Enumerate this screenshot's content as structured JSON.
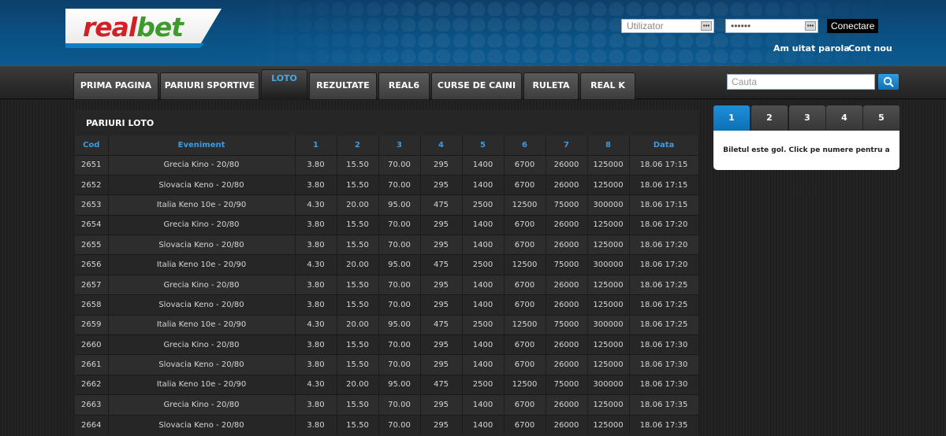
{
  "brand": {
    "logo_real": "real",
    "logo_bet": "bet"
  },
  "login": {
    "username_placeholder": "Utilizator",
    "password_value": "••••••",
    "login_button": "Conectare",
    "forgot_password": "Am uitat parola",
    "new_account": "Cont nou"
  },
  "nav": {
    "tabs": [
      {
        "label": "PRIMA PAGINA",
        "active": false
      },
      {
        "label": "PARIURI SPORTIVE",
        "active": false
      },
      {
        "label": "LOTO",
        "active": true
      },
      {
        "label": "REZULTATE",
        "active": false
      },
      {
        "label": "REAL6",
        "active": false
      },
      {
        "label": "CURSE DE CAINI",
        "active": false
      },
      {
        "label": "RULETA",
        "active": false
      },
      {
        "label": "REAL K",
        "active": false
      }
    ],
    "search_placeholder": "Cauta",
    "search_icon": "search-icon"
  },
  "main": {
    "section_title": "PARIURI LOTO",
    "columns": [
      "Cod",
      "Eveniment",
      "1",
      "2",
      "3",
      "4",
      "5",
      "6",
      "7",
      "8",
      "Data"
    ],
    "rows": [
      [
        "2651",
        "Grecia Kino - 20/80",
        "3.80",
        "15.50",
        "70.00",
        "295",
        "1400",
        "6700",
        "26000",
        "125000",
        "18.06 17:15"
      ],
      [
        "2652",
        "Slovacia Keno - 20/80",
        "3.80",
        "15.50",
        "70.00",
        "295",
        "1400",
        "6700",
        "26000",
        "125000",
        "18.06 17:15"
      ],
      [
        "2653",
        "Italia Keno 10e - 20/90",
        "4.30",
        "20.00",
        "95.00",
        "475",
        "2500",
        "12500",
        "75000",
        "300000",
        "18.06 17:15"
      ],
      [
        "2654",
        "Grecia Kino - 20/80",
        "3.80",
        "15.50",
        "70.00",
        "295",
        "1400",
        "6700",
        "26000",
        "125000",
        "18.06 17:20"
      ],
      [
        "2655",
        "Slovacia Keno - 20/80",
        "3.80",
        "15.50",
        "70.00",
        "295",
        "1400",
        "6700",
        "26000",
        "125000",
        "18.06 17:20"
      ],
      [
        "2656",
        "Italia Keno 10e - 20/90",
        "4.30",
        "20.00",
        "95.00",
        "475",
        "2500",
        "12500",
        "75000",
        "300000",
        "18.06 17:20"
      ],
      [
        "2657",
        "Grecia Kino - 20/80",
        "3.80",
        "15.50",
        "70.00",
        "295",
        "1400",
        "6700",
        "26000",
        "125000",
        "18.06 17:25"
      ],
      [
        "2658",
        "Slovacia Keno - 20/80",
        "3.80",
        "15.50",
        "70.00",
        "295",
        "1400",
        "6700",
        "26000",
        "125000",
        "18.06 17:25"
      ],
      [
        "2659",
        "Italia Keno 10e - 20/90",
        "4.30",
        "20.00",
        "95.00",
        "475",
        "2500",
        "12500",
        "75000",
        "300000",
        "18.06 17:25"
      ],
      [
        "2660",
        "Grecia Kino - 20/80",
        "3.80",
        "15.50",
        "70.00",
        "295",
        "1400",
        "6700",
        "26000",
        "125000",
        "18.06 17:30"
      ],
      [
        "2661",
        "Slovacia Keno - 20/80",
        "3.80",
        "15.50",
        "70.00",
        "295",
        "1400",
        "6700",
        "26000",
        "125000",
        "18.06 17:30"
      ],
      [
        "2662",
        "Italia Keno 10e - 20/90",
        "4.30",
        "20.00",
        "95.00",
        "475",
        "2500",
        "12500",
        "75000",
        "300000",
        "18.06 17:30"
      ],
      [
        "2663",
        "Grecia Kino - 20/80",
        "3.80",
        "15.50",
        "70.00",
        "295",
        "1400",
        "6700",
        "26000",
        "125000",
        "18.06 17:35"
      ],
      [
        "2664",
        "Slovacia Keno - 20/80",
        "3.80",
        "15.50",
        "70.00",
        "295",
        "1400",
        "6700",
        "26000",
        "125000",
        "18.06 17:35"
      ]
    ]
  },
  "slip": {
    "tabs": [
      "1",
      "2",
      "3",
      "4",
      "5"
    ],
    "active_tab": "1",
    "empty_message": "Biletul este gol. Click pe numere pentru a paria!"
  },
  "colors": {
    "accent": "#1e8ed8",
    "header_blue": "#0a5184",
    "logo_red": "#d31f26",
    "logo_green": "#3d9b2b",
    "table_header_text": "#3c9be0"
  }
}
